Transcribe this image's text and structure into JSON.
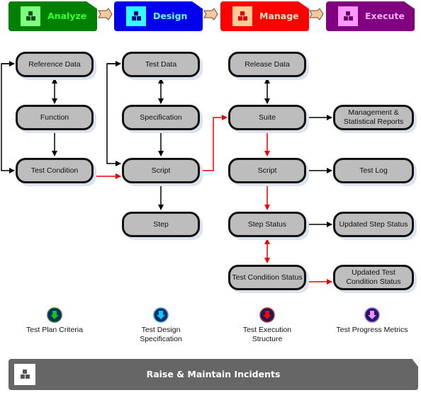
{
  "phases": [
    {
      "label": "Analyze",
      "bg": "#008000",
      "icon_bg": "#80ff80",
      "text": "#33ff33",
      "block": "#004d00"
    },
    {
      "label": "Design",
      "bg": "#0000ee",
      "icon_bg": "#33ffff",
      "text": "#66ffff",
      "block": "#00008b"
    },
    {
      "label": "Manage",
      "bg": "#ff0000",
      "icon_bg": "#ffcc99",
      "text": "#ffe0c0",
      "block": "#e00000"
    },
    {
      "label": "Execute",
      "bg": "#800080",
      "icon_bg": "#ff99ff",
      "text": "#ffaaff",
      "block": "#660066"
    }
  ],
  "nodes": {
    "reference_data": "Reference Data",
    "function": "Function",
    "test_condition": "Test Condition",
    "test_data": "Test Data",
    "specification": "Specification",
    "design_script": "Script",
    "step": "Step",
    "release_data": "Release Data",
    "suite": "Suite",
    "manage_script": "Script",
    "step_status": "Step Status",
    "test_condition_status": "Test Condition Status",
    "mgmt_reports": "Management & Statistical Reports",
    "test_log": "Test Log",
    "updated_step_status": "Updated Step Status",
    "updated_test_condition_status": "Updated Test Condition Status"
  },
  "legend": [
    {
      "label": "Test Plan Criteria",
      "color": "#00cc00"
    },
    {
      "label": "Test Design Specification",
      "color": "#00ccff"
    },
    {
      "label": "Test Execution Structure",
      "color": "#ff0000"
    },
    {
      "label": "Test Progress Metrics",
      "color": "#ff88ff"
    }
  ],
  "banner": {
    "label": "Raise & Maintain Incidents"
  },
  "colors": {
    "flow_black": "#000000",
    "flow_red": "#ee0000"
  }
}
